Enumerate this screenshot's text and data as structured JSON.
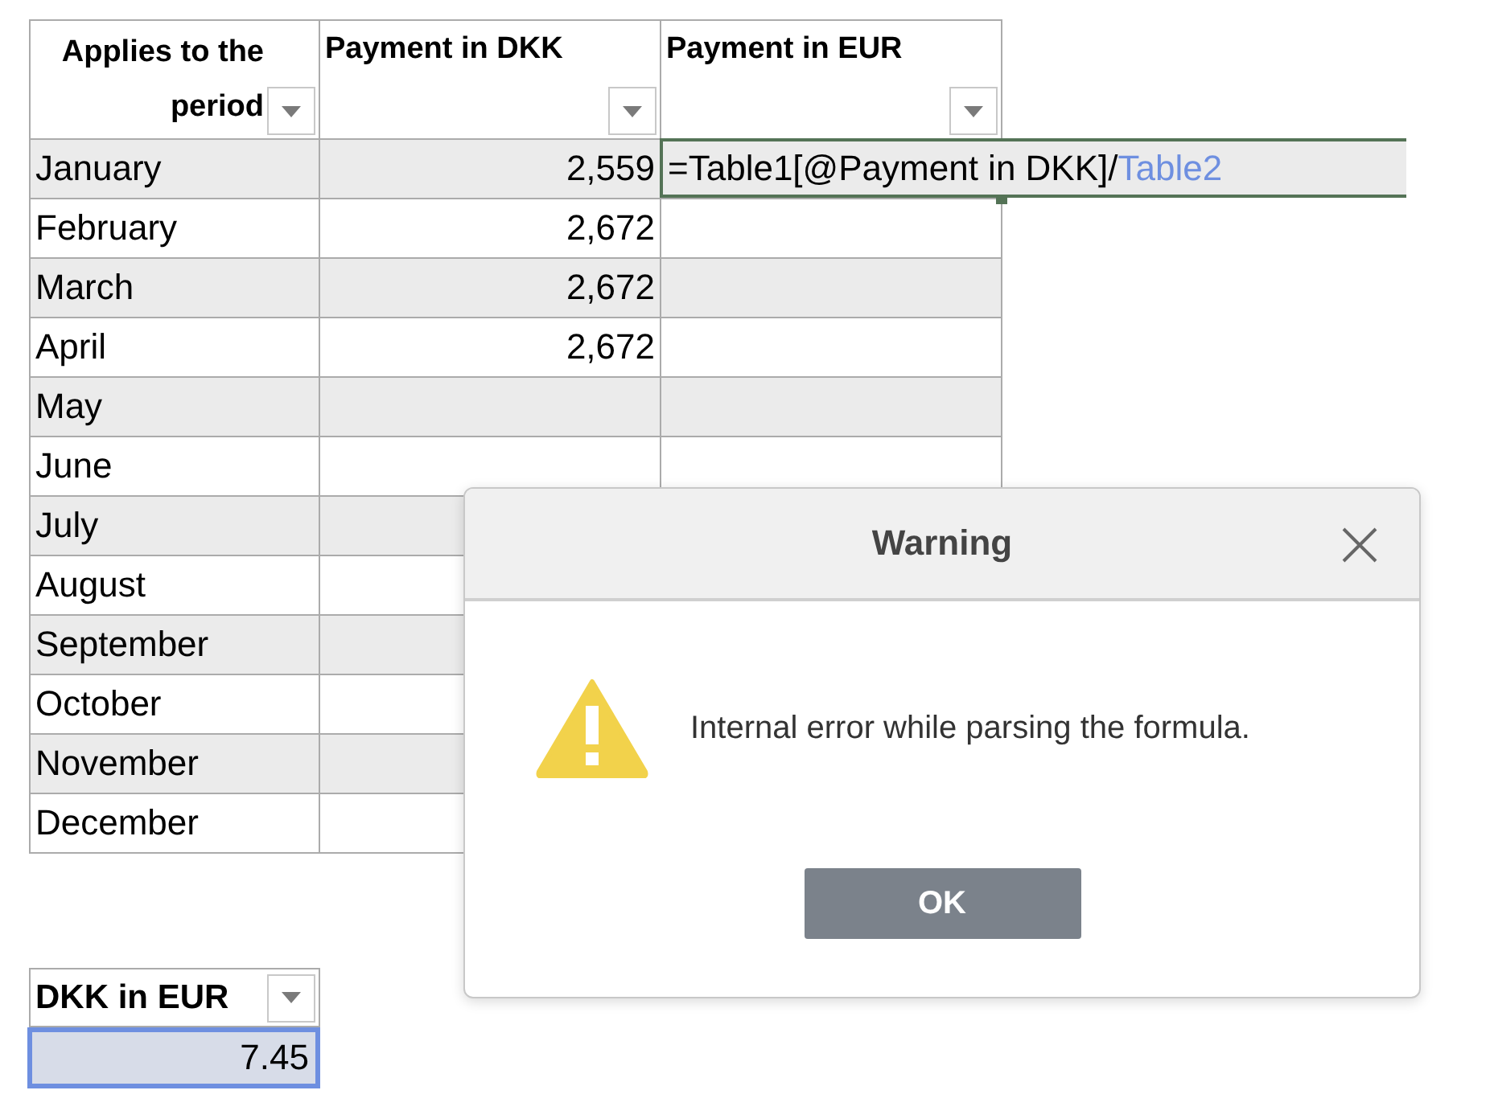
{
  "table": {
    "columns": [
      {
        "label": "Applies to the period"
      },
      {
        "label": "Payment in DKK"
      },
      {
        "label": "Payment in EUR"
      }
    ],
    "rows": [
      {
        "period": "January",
        "dkk": "2,559",
        "formula": [
          {
            "kind": "plain",
            "text": "=Table1[@Payment in DKK]/"
          },
          {
            "kind": "ref",
            "text": "Table2"
          }
        ]
      },
      {
        "period": "February",
        "dkk": "2,672"
      },
      {
        "period": "March",
        "dkk": "2,672"
      },
      {
        "period": "April",
        "dkk": "2,672"
      },
      {
        "period": "May"
      },
      {
        "period": "June"
      },
      {
        "period": "July"
      },
      {
        "period": "August"
      },
      {
        "period": "September"
      },
      {
        "period": "October"
      },
      {
        "period": "November"
      },
      {
        "period": "December"
      }
    ]
  },
  "rate_table": {
    "column": "DKK in EUR",
    "value": "7.45",
    "selected": true
  },
  "dialog": {
    "title": "Warning",
    "message": "Internal error while parsing the formula.",
    "buttons": [
      "OK"
    ]
  }
}
